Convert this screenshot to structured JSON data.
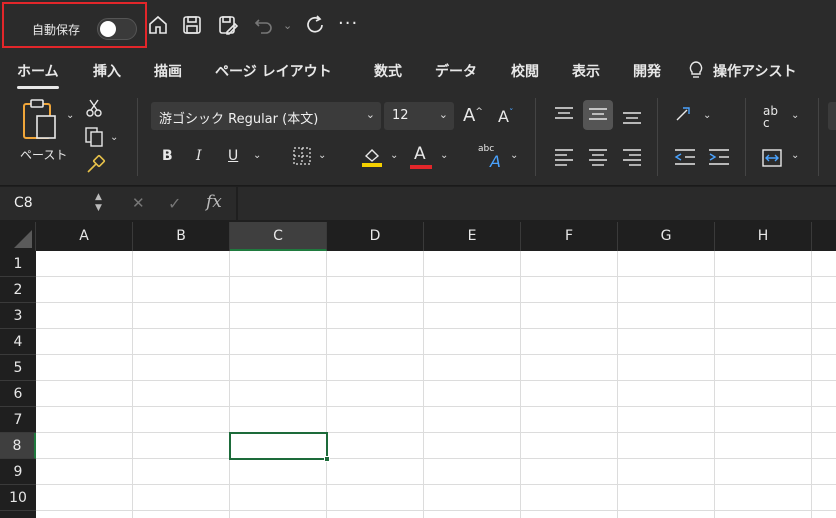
{
  "titlebar": {
    "autosave_label": "自動保存",
    "autosave_state": "off",
    "icons": [
      "home-icon",
      "save-icon",
      "save-as-icon",
      "undo-icon",
      "redo-icon",
      "more-icon"
    ],
    "more_label": "···",
    "undo_caret": "⌄"
  },
  "tabs": [
    {
      "label": "ホーム",
      "active": true
    },
    {
      "label": "挿入"
    },
    {
      "label": "描画"
    },
    {
      "label": "ページ レイアウト"
    },
    {
      "label": "数式"
    },
    {
      "label": "データ"
    },
    {
      "label": "校閲"
    },
    {
      "label": "表示"
    },
    {
      "label": "開発"
    },
    {
      "label": "操作アシスト"
    }
  ],
  "ribbon": {
    "paste_label": "ペースト",
    "font_name": "游ゴシック Regular (本文)",
    "font_size": "12",
    "bold": "B",
    "italic": "I",
    "underline": "U",
    "grow_font": "A",
    "shrink_font": "A",
    "font_color_letter": "A",
    "phonetic_label": "abc",
    "phonetic_letter": "A",
    "wrap_label_top": "ab",
    "wrap_label_bottom": "c",
    "fill_color": "#f5d000",
    "font_color": "#e3262a"
  },
  "formula_bar": {
    "name_box": "C8",
    "cancel": "✕",
    "enter": "✓",
    "fx": "fx",
    "value": ""
  },
  "sheet": {
    "columns": [
      "A",
      "B",
      "C",
      "D",
      "E",
      "F",
      "G",
      "H"
    ],
    "rows": [
      "1",
      "2",
      "3",
      "4",
      "5",
      "6",
      "7",
      "8",
      "9",
      "10"
    ],
    "selected_cell": "C8"
  },
  "colors": {
    "accent_green": "#1d6b3a",
    "highlight_box": "#e3262a"
  }
}
